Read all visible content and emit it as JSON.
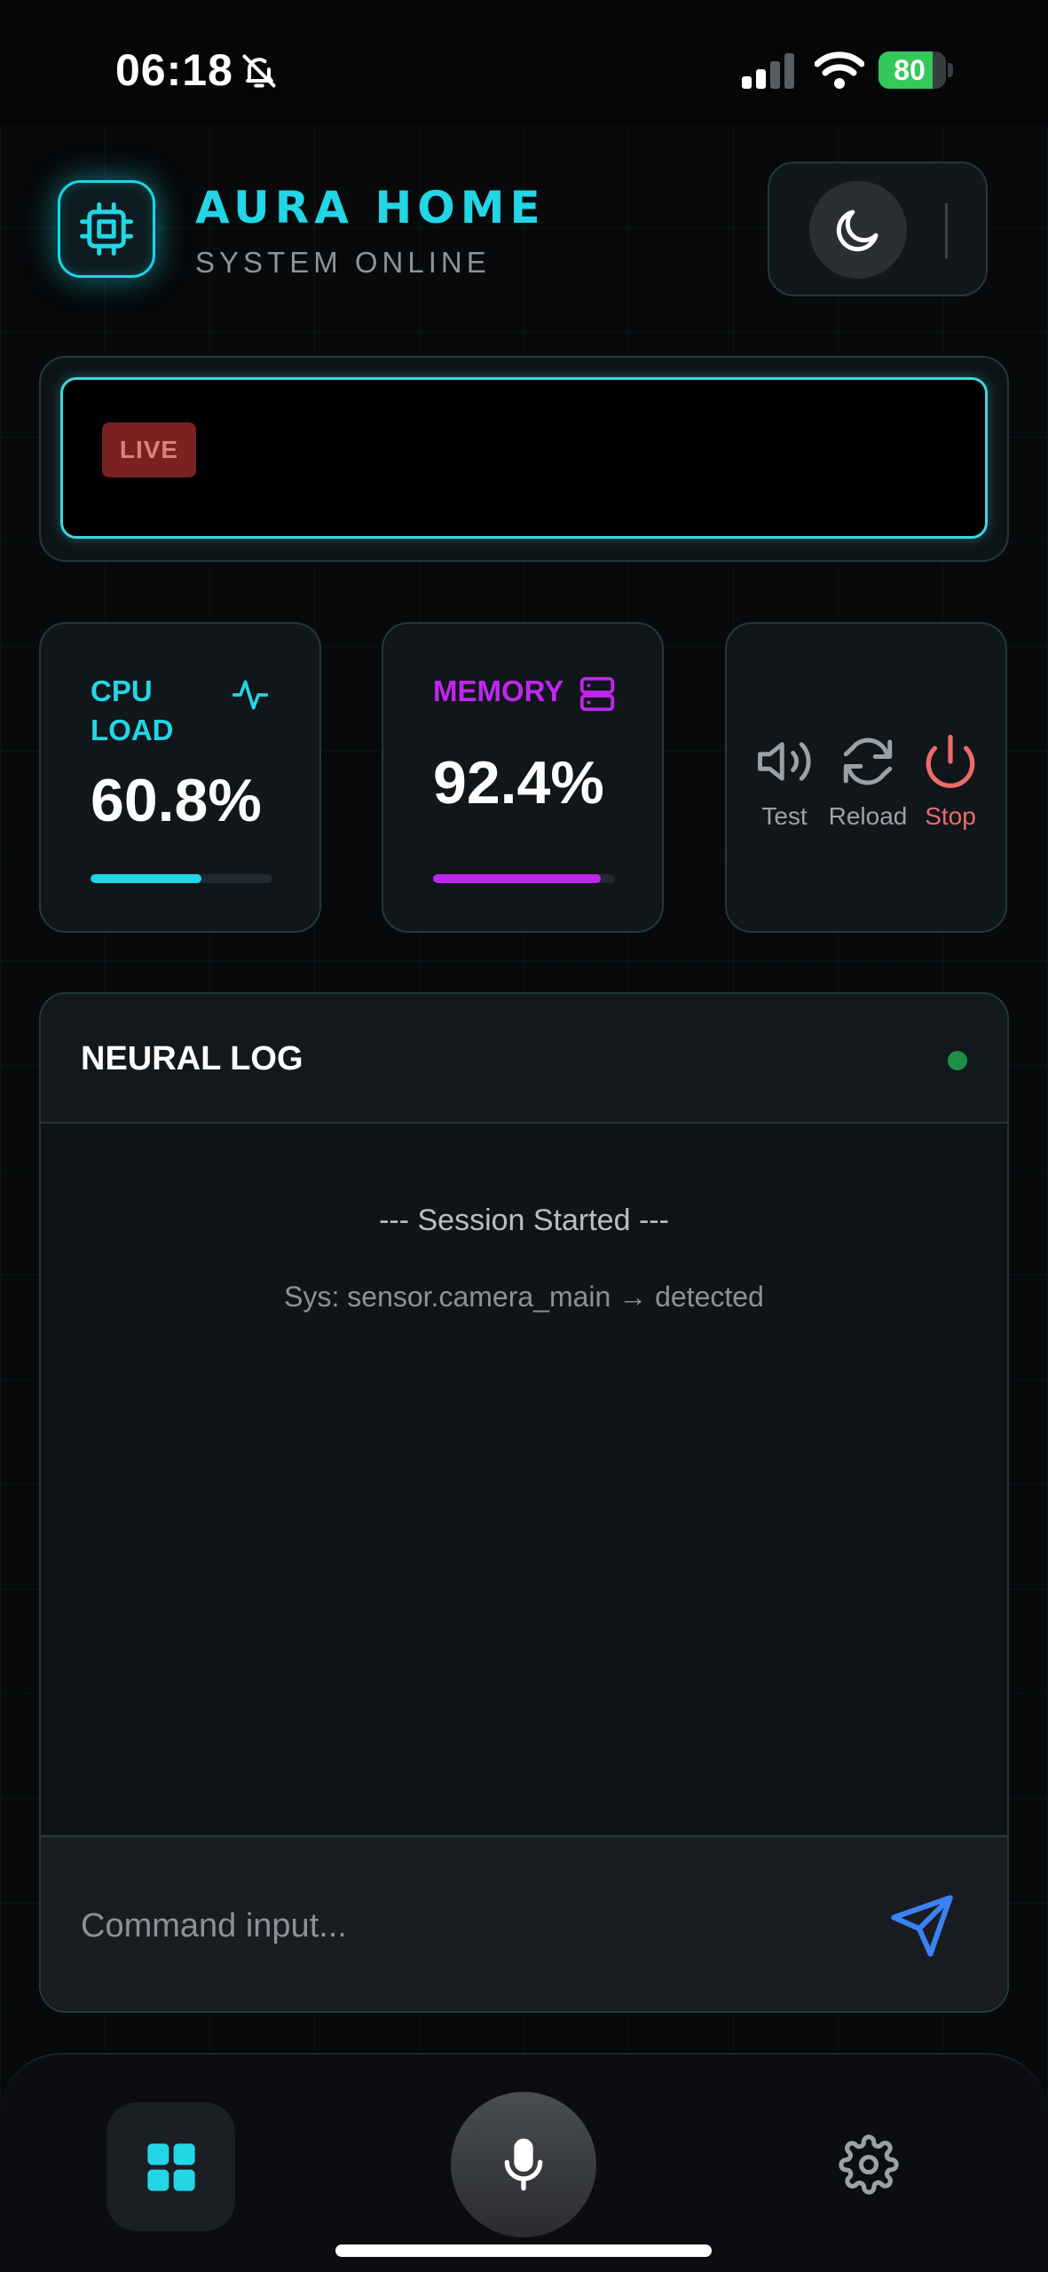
{
  "status_bar": {
    "time": "06:18",
    "battery": "80",
    "battery_level": 0.8
  },
  "header": {
    "title": "AURA HOME",
    "subtitle": "SYSTEM ONLINE"
  },
  "live": {
    "badge": "LIVE"
  },
  "cpu": {
    "label": "CPU LOAD",
    "value": "60.8%",
    "fraction": 0.608,
    "color": "#22d6e6"
  },
  "memory": {
    "label": "MEMORY",
    "value": "92.4%",
    "fraction": 0.924,
    "color": "#c026f0"
  },
  "controls": {
    "test": "Test",
    "reload": "Reload",
    "stop": "Stop"
  },
  "log": {
    "title": "NEURAL LOG",
    "lines": [
      "--- Session Started ---",
      "Sys: sensor.camera_main → detected"
    ]
  },
  "command": {
    "placeholder": "Command input..."
  },
  "colors": {
    "accent": "#22d6e6",
    "memory": "#c026f0",
    "danger": "#f06a6a",
    "send": "#3b82f6",
    "online_dot": "#1f8f48"
  }
}
